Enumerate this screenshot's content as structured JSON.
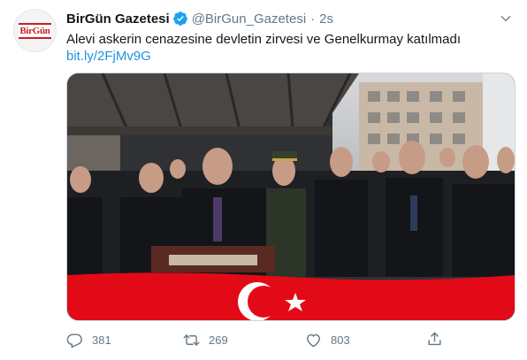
{
  "tweet": {
    "author_name": "BirGün Gazetesi",
    "author_handle": "@BirGun_Gazetesi",
    "separator": "·",
    "time": "2s",
    "avatar_logo": "BirGün",
    "text": "Alevi askerin cenazesine devletin zirvesi ve Genelkurmay katılmadı",
    "link": "bit.ly/2FjMv9G",
    "photo_description_icon": "funeral-photo",
    "replies": "381",
    "retweets": "269",
    "likes": "803"
  },
  "colors": {
    "link": "#1b95e0",
    "verified": "#1da1f2",
    "muted": "#657786",
    "flag_red": "#e30a17",
    "logo_red": "#c81d25"
  }
}
